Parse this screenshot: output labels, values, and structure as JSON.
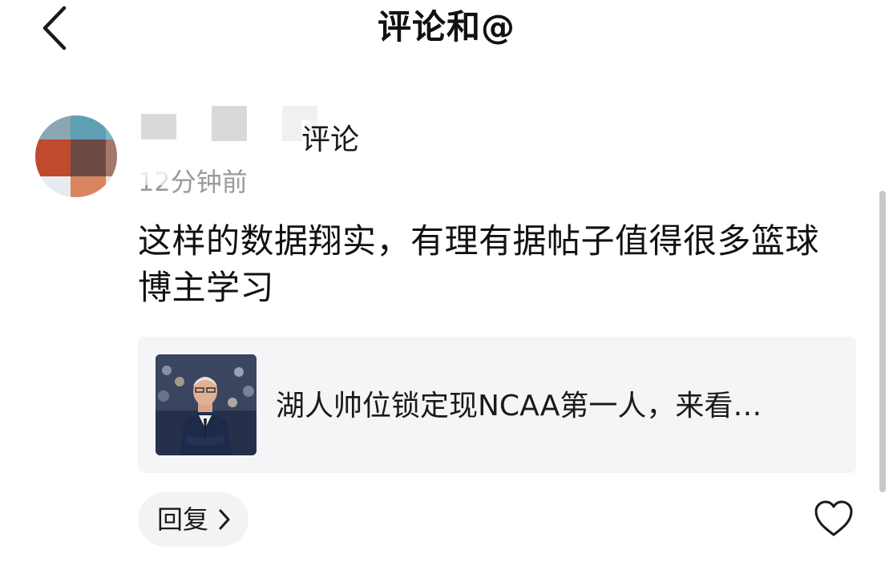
{
  "header": {
    "title": "评论和@",
    "back_icon": "chevron-left-icon"
  },
  "comment": {
    "author_suffix": "评论",
    "timestamp": "12分钟前",
    "text": "这样的数据翔实，有理有据帖子值得很多篮球博主学习",
    "linked_post": {
      "title": "湖人帅位锁定现NCAA第一人，来看…",
      "thumbnail_icon": "coach-photo-thumbnail"
    },
    "reply_label": "回复",
    "reply_icon": "chevron-right-icon",
    "like_icon": "heart-outline-icon"
  },
  "colors": {
    "background": "#ffffff",
    "card_background": "#f5f5f7",
    "timestamp": "#9a9a9a",
    "text": "#111111",
    "scrollbar": "#c8c8cc"
  }
}
